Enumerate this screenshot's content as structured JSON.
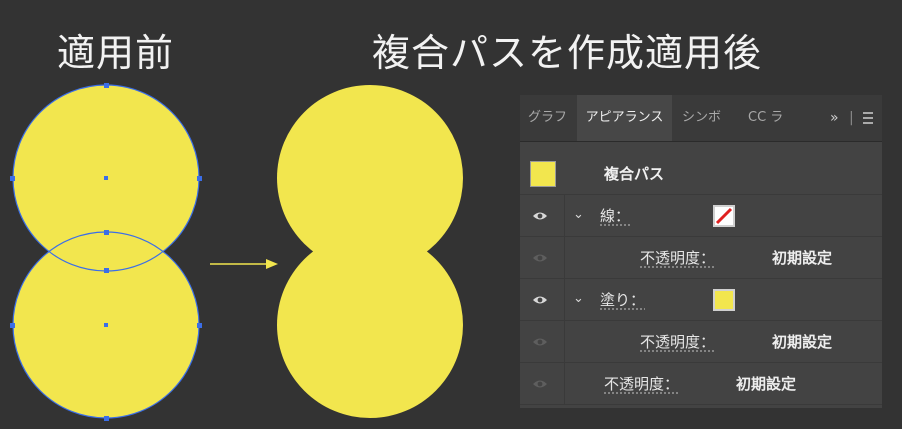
{
  "headings": {
    "before": "適用前",
    "after": "複合パスを作成適用後"
  },
  "colors": {
    "background": "#333333",
    "fill_yellow": "#f2e64e",
    "selection_blue": "#3b6ee8",
    "arrow": "#f2e64e",
    "panel": "#434343"
  },
  "panel": {
    "tabs": [
      {
        "label": "グラフ",
        "active": false
      },
      {
        "label": "アピアランス",
        "active": true
      },
      {
        "label": "シンボ",
        "active": false
      },
      {
        "label": "CC ラ",
        "active": false
      }
    ],
    "more_label": "»",
    "separator": "|",
    "menu_icon": "hamburger-icon",
    "object_label": "複合パス",
    "stroke_label": "線：",
    "fill_label": "塗り：",
    "opacity_label": "不透明度：",
    "opacity_value": "初期設定"
  }
}
